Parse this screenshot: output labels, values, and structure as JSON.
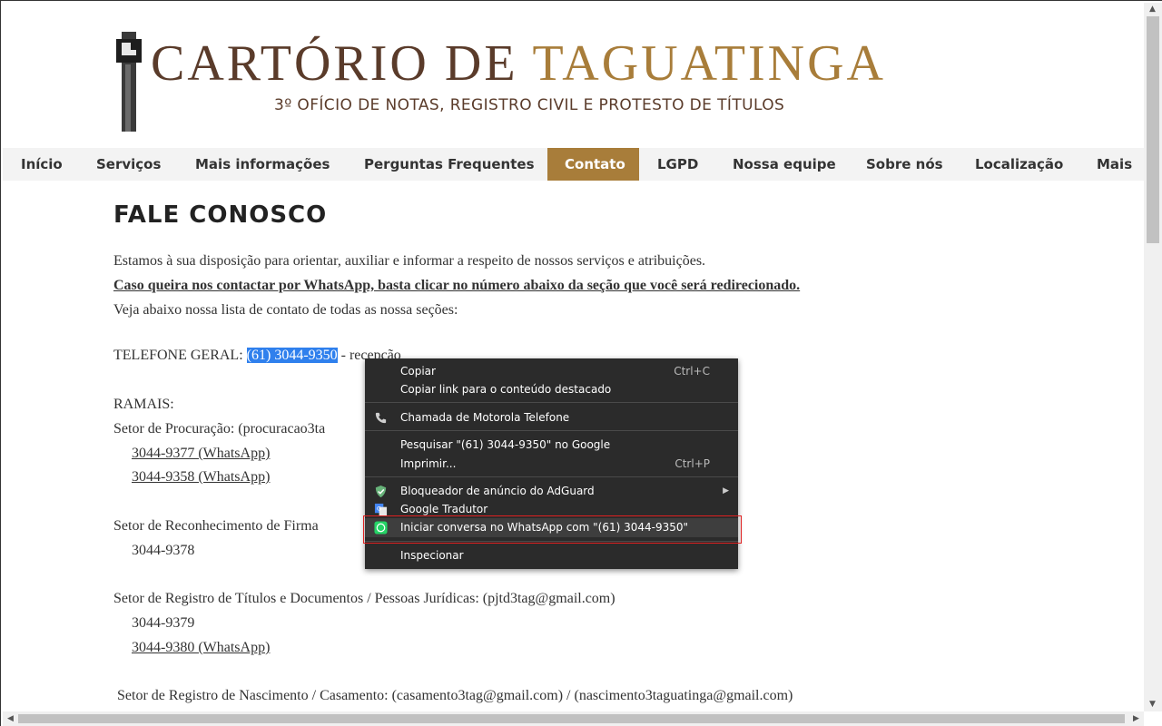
{
  "header": {
    "title_part1": "CARTÓRIO DE",
    "title_part2": "TAGUATINGA",
    "subtitle": "3º OFÍCIO DE NOTAS, REGISTRO CIVIL E PROTESTO DE TÍTULOS",
    "colors": {
      "dark_brown": "#5a3b2a",
      "gold": "#a87d3a"
    }
  },
  "nav": {
    "items": [
      {
        "label": "Início",
        "active": false
      },
      {
        "label": "Serviços",
        "active": false
      },
      {
        "label": "Mais informações",
        "active": false
      },
      {
        "label": "Perguntas Frequentes",
        "active": false
      },
      {
        "label": "Contato",
        "active": true
      },
      {
        "label": "LGPD",
        "active": false
      },
      {
        "label": "Nossa equipe",
        "active": false
      },
      {
        "label": "Sobre nós",
        "active": false
      },
      {
        "label": "Localização",
        "active": false
      },
      {
        "label": "Mais",
        "active": false
      }
    ]
  },
  "page": {
    "heading": "FALE CONOSCO",
    "intro": "Estamos à sua disposição para orientar, auxiliar e informar a respeito de nossos serviços e atribuições.",
    "whatsapp_note": "Caso queira nos contactar por WhatsApp, basta clicar no número abaixo da seção que você será redirecionado.",
    "list_note": "Veja abaixo nossa lista de contato de todas as nossa seções:",
    "telefone_label": "TELEFONE GERAL: ",
    "telefone_number": "(61) 3044-9350",
    "telefone_suffix": " - recepção",
    "ramais_label": "RAMAIS:",
    "procuracao_label": "Setor de Procuração: (procuracao3ta",
    "procuracao_phone1": "3044-9377 (WhatsApp)",
    "procuracao_phone2": "3044-9358 (WhatsApp)",
    "firma_label": "Setor de Reconhecimento de Firma",
    "firma_phone": "3044-9378",
    "titulos_label": "Setor de Registro de Títulos e Documentos / Pessoas Jurídicas: (pjtd3tag@gmail.com)",
    "titulos_phone1": "3044-9379",
    "titulos_phone2": "3044-9380 (WhatsApp)",
    "nascimento_label": "Setor de Registro de Nascimento / Casamento: (casamento3tag@gmail.com) / (nascimento3taguatinga@gmail.com)"
  },
  "context_menu": {
    "copy": "Copiar",
    "copy_shortcut": "Ctrl+C",
    "copy_link": "Copiar link para o conteúdo destacado",
    "call": "Chamada de Motorola Telefone",
    "search": "Pesquisar \"(61) 3044-9350\" no Google",
    "print": "Imprimir...",
    "print_shortcut": "Ctrl+P",
    "adguard": "Bloqueador de anúncio do AdGuard",
    "translate": "Google Tradutor",
    "whatsapp": "Iniciar conversa no WhatsApp com \"(61) 3044-9350\"",
    "inspect": "Inspecionar"
  }
}
